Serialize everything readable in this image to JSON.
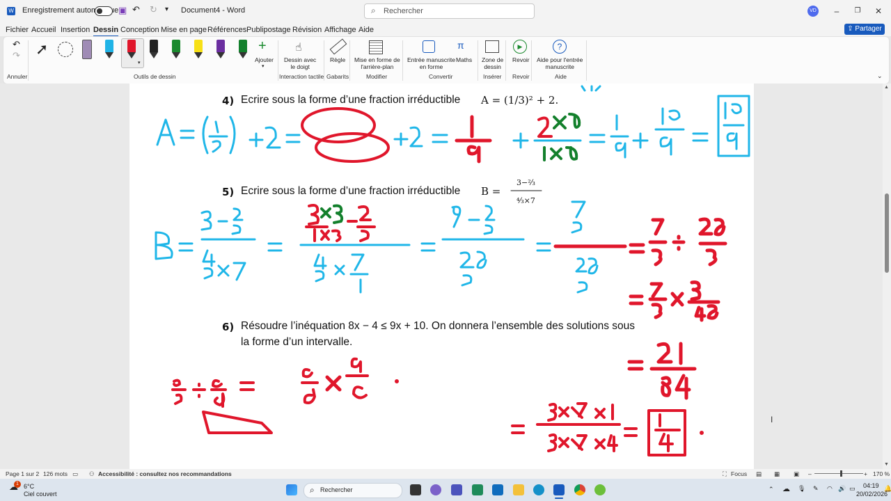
{
  "titlebar": {
    "autosave_label": "Enregistrement automatique",
    "doc_title": "Document4 - Word",
    "search_placeholder": "Rechercher",
    "user_initials": "VD"
  },
  "menu": {
    "items": [
      "Fichier",
      "Accueil",
      "Insertion",
      "Dessin",
      "Conception",
      "Mise en page",
      "Références",
      "Publipostage",
      "Révision",
      "Affichage",
      "Aide"
    ],
    "active": "Dessin",
    "share_label": "Partager"
  },
  "ribbon": {
    "groups": {
      "undo": "Annuler",
      "drawing_tools": "Outils de dessin",
      "touch": "Interaction tactile",
      "stencils": "Gabarits",
      "modify": "Modifier",
      "convert": "Convertir",
      "insert": "Insérer",
      "replay": "Revoir",
      "help": "Aide"
    },
    "buttons": {
      "add": "Ajouter",
      "draw_finger": "Dessin avec\nle doigt",
      "ruler": "Règle",
      "background": "Mise en forme de\nl'arrière-plan",
      "ink_to_shape": "Entrée manuscrite\nen forme",
      "math": "Maths",
      "drawing_canvas": "Zone de\ndessin",
      "replay": "Revoir",
      "ink_help": "Aide pour l'entrée\nmanuscrite"
    },
    "pen_colors": [
      "#222222",
      "#1a8a2e",
      "#f7e017",
      "#6b2fa0",
      "#13802c"
    ],
    "accent": "#185abd"
  },
  "document": {
    "q4": {
      "num": "4)",
      "text": "Ecrire sous la forme d’une fraction irréductible",
      "math": "A = (1/3)² + 2."
    },
    "q5": {
      "num": "5)",
      "text": "Ecrire sous la forme d’une fraction irréductible",
      "math": "B ="
    },
    "q6": {
      "num": "6)",
      "line1": "Résoudre l’inéquation 8x − 4 ≤ 9x + 10. On donnera l’ensemble des solutions sous",
      "line2": "la forme d’un intervalle."
    }
  },
  "statusbar": {
    "page": "Page 1 sur 2",
    "words": "126 mots",
    "accessibility": "Accessibilité : consultez nos recommandations",
    "focus": "Focus",
    "zoom": "170 %"
  },
  "taskbar": {
    "weather_temp": "6°C",
    "weather_desc": "Ciel couvert",
    "search_label": "Rechercher",
    "time": "04:19",
    "date": "20/02/2026",
    "badge": "1"
  }
}
